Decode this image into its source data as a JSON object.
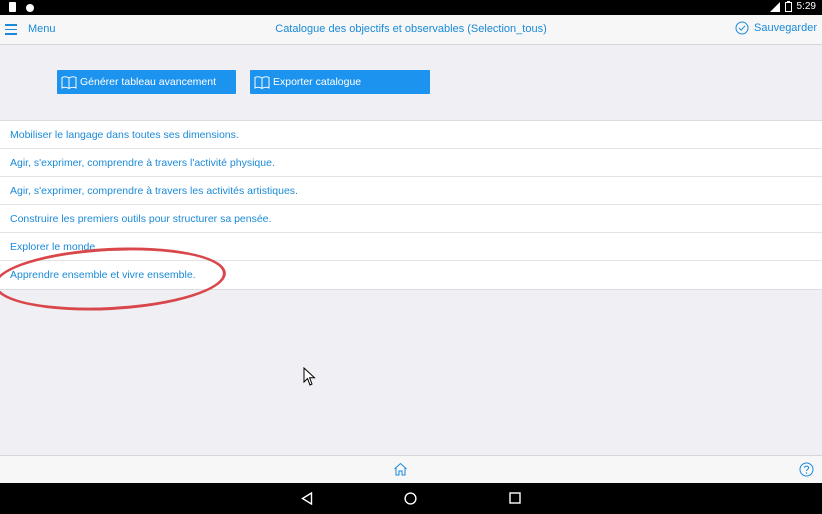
{
  "statusbar": {
    "time": "5:29"
  },
  "navbar": {
    "menu_label": "Menu",
    "title": "Catalogue des objectifs et observables (Selection_tous)",
    "save_label": "Sauvegarder"
  },
  "actions": {
    "generate_label": "Générer tableau avancement",
    "export_label": "Exporter catalogue"
  },
  "list": {
    "items": [
      {
        "label": "Mobiliser le langage dans toutes ses dimensions."
      },
      {
        "label": "Agir, s'exprimer, comprendre à travers l'activité physique."
      },
      {
        "label": "Agir, s'exprimer, comprendre à travers les activités artistiques."
      },
      {
        "label": "Construire les premiers outils pour structurer sa pensée."
      },
      {
        "label": "Explorer le monde."
      },
      {
        "label": "Apprendre ensemble et vivre ensemble."
      }
    ]
  },
  "colors": {
    "accent": "#1a8ad8",
    "button": "#1c93ee",
    "annotation": "#d9474b"
  }
}
